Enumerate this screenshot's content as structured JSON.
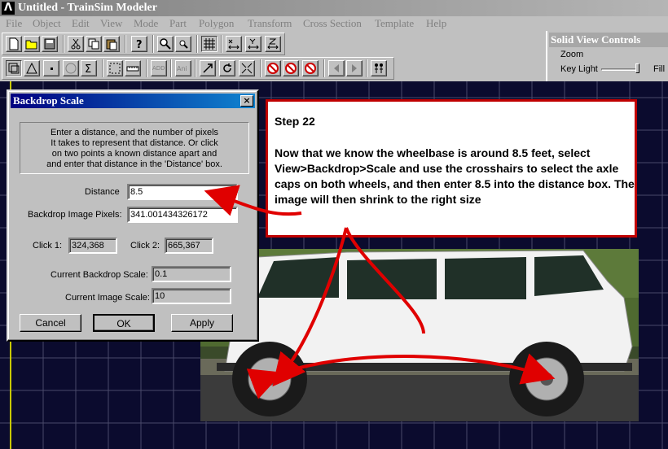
{
  "app": {
    "title": "Untitled - TrainSim Modeler",
    "icon": "Λ"
  },
  "menu": [
    "File",
    "Object",
    "Edit",
    "View",
    "Mode",
    "Part",
    "Polygon",
    "Transform",
    "Cross Section",
    "Template",
    "Help"
  ],
  "toolbar1": [
    "new-icon",
    "open-icon",
    "save-icon",
    "cut-icon",
    "copy-icon",
    "paste-icon",
    "help-icon",
    "zoom-icon",
    "zoom-small-icon",
    "grid-icon",
    "flip-x-icon",
    "flip-y-icon",
    "flip-z-icon"
  ],
  "toolbar2": [
    "box-icon",
    "triangle-icon",
    "point-icon",
    "circle-icon",
    "sigma-icon",
    "select-icon",
    "ruler-icon",
    "add-icon",
    "anim-icon",
    "arrow-icon",
    "rotate-icon",
    "shrink-icon",
    "no-select-icon",
    "no-move-icon",
    "no-rotate-icon",
    "prev-icon",
    "next-icon",
    "figures-icon"
  ],
  "solid_view": {
    "title": "Solid View Controls",
    "zoom_label": "Zoom",
    "key_light_label": "Key Light",
    "fill_label": "Fill L"
  },
  "dialog": {
    "title": "Backdrop Scale",
    "close": "×",
    "instructions": [
      "Enter a distance, and the number of pixels",
      "It takes to represent that distance.  Or click",
      "on two points a known distance apart and",
      "and enter that distance in the 'Distance' box."
    ],
    "distance_label": "Distance",
    "distance_value": "8.5",
    "pixels_label": "Backdrop Image Pixels:",
    "pixels_value": "341.001434326172",
    "click1_label": "Click 1:",
    "click1_value": "324,368",
    "click2_label": "Click 2:",
    "click2_value": "665,367",
    "backdrop_scale_label": "Current Backdrop Scale:",
    "backdrop_scale_value": "0.1",
    "image_scale_label": "Current Image Scale:",
    "image_scale_value": "10",
    "cancel": "Cancel",
    "ok": "OK",
    "apply": "Apply"
  },
  "callout": {
    "title": "Step 22",
    "body": "Now that we know the wheelbase is around 8.5 feet, select View>Backdrop>Scale and use the crosshairs to select the axle caps on both wheels, and then enter 8.5 into the distance box. The image will then shrink to the right size"
  },
  "colors": {
    "workspace": "#0b0b2e",
    "grid": "#4a4a6a",
    "annotation": "#e00000",
    "dialog_title": "#000080"
  }
}
